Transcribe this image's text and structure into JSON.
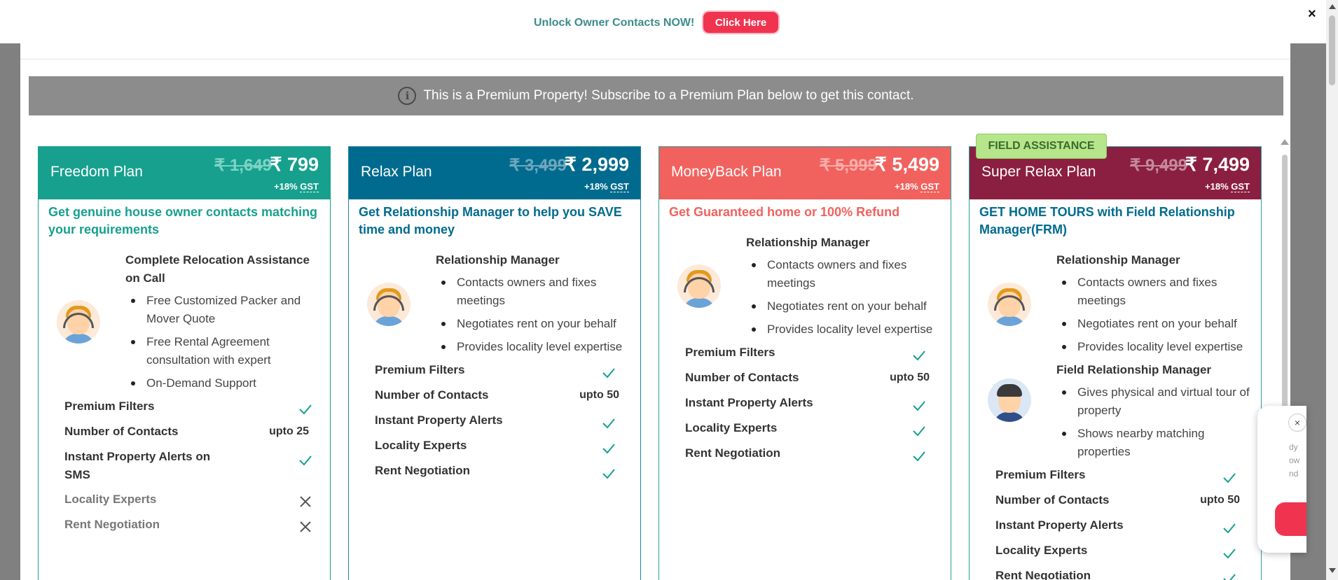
{
  "topbar": {
    "unlock_text": "Unlock Owner Contacts NOW!",
    "click_label": "Click Here",
    "close_glyph": "×"
  },
  "banner": {
    "info_glyph": "i",
    "text": "This is a Premium Property! Subscribe to a Premium Plan below to get this contact."
  },
  "badge": {
    "field_assistance": "FIELD ASSISTANCE"
  },
  "check_glyph": "✓",
  "cross_glyph": "✕",
  "plans": [
    {
      "name": "Freedom Plan",
      "old_price": "₹ 1,649",
      "new_price": "₹ 799",
      "gst_prefix": "+18%",
      "gst": "GST",
      "color": "#17a08e",
      "tagline": "Get genuine house owner contacts matching your requirements",
      "section_title": "Complete Relocation Assistance on Call",
      "bullets": [
        "Free Customized Packer and Mover Quote",
        "Free Rental Agreement consultation with expert",
        "On-Demand Support"
      ],
      "features": [
        {
          "label": "Premium Filters",
          "value": "check"
        },
        {
          "label": "Number of Contacts",
          "value": "upto 25"
        },
        {
          "label": "Instant Property Alerts on SMS",
          "value": "check"
        },
        {
          "label": "Locality Experts",
          "value": "cross"
        },
        {
          "label": "Rent Negotiation",
          "value": "cross"
        }
      ]
    },
    {
      "name": "Relax Plan",
      "old_price": "₹ 3,499",
      "new_price": "₹ 2,999",
      "gst_prefix": "+18%",
      "gst": "GST",
      "color": "#006b8f",
      "tagline": "Get Relationship Manager to help you SAVE time and money",
      "section_title": "Relationship Manager",
      "bullets": [
        "Contacts owners and fixes meetings",
        "Negotiates rent on your behalf",
        "Provides locality level expertise"
      ],
      "features": [
        {
          "label": "Premium Filters",
          "value": "check"
        },
        {
          "label": "Number of Contacts",
          "value": "upto 50"
        },
        {
          "label": "Instant Property Alerts",
          "value": "check"
        },
        {
          "label": "Locality Experts",
          "value": "check"
        },
        {
          "label": "Rent Negotiation",
          "value": "check"
        }
      ]
    },
    {
      "name": "MoneyBack Plan",
      "old_price": "₹ 5,999",
      "new_price": "₹ 5,499",
      "gst_prefix": "+18%",
      "gst": "GST",
      "color": "#f1625e",
      "tagline": "Get Guaranteed home or 100% Refund",
      "section_title": "Relationship Manager",
      "bullets": [
        "Contacts owners and fixes meetings",
        "Negotiates rent on your behalf",
        "Provides locality level expertise"
      ],
      "features": [
        {
          "label": "Premium Filters",
          "value": "check"
        },
        {
          "label": "Number of Contacts",
          "value": "upto 50"
        },
        {
          "label": "Instant Property Alerts",
          "value": "check"
        },
        {
          "label": "Locality Experts",
          "value": "check"
        },
        {
          "label": "Rent Negotiation",
          "value": "check"
        }
      ]
    },
    {
      "name": "Super Relax Plan",
      "old_price": "₹ 9,499",
      "new_price": "₹ 7,499",
      "gst_prefix": "+18%",
      "gst": "GST",
      "color": "#8b1f41",
      "tagline": "GET HOME TOURS with Field Relationship Manager(FRM)",
      "section_title": "Relationship Manager",
      "bullets": [
        "Contacts owners and fixes meetings",
        "Negotiates rent on your behalf",
        "Provides locality level expertise"
      ],
      "section2_title": "Field Relationship Manager",
      "bullets2": [
        "Gives physical and virtual tour of property",
        "Shows nearby matching properties"
      ],
      "features": [
        {
          "label": "Premium Filters",
          "value": "check"
        },
        {
          "label": "Number of Contacts",
          "value": "upto 50"
        },
        {
          "label": "Instant Property Alerts",
          "value": "check"
        },
        {
          "label": "Locality Experts",
          "value": "check"
        },
        {
          "label": "Rent Negotiation",
          "value": "check"
        }
      ]
    }
  ],
  "chat": {
    "close_glyph": "×",
    "lines": [
      "dy",
      "ow",
      "nd"
    ]
  }
}
